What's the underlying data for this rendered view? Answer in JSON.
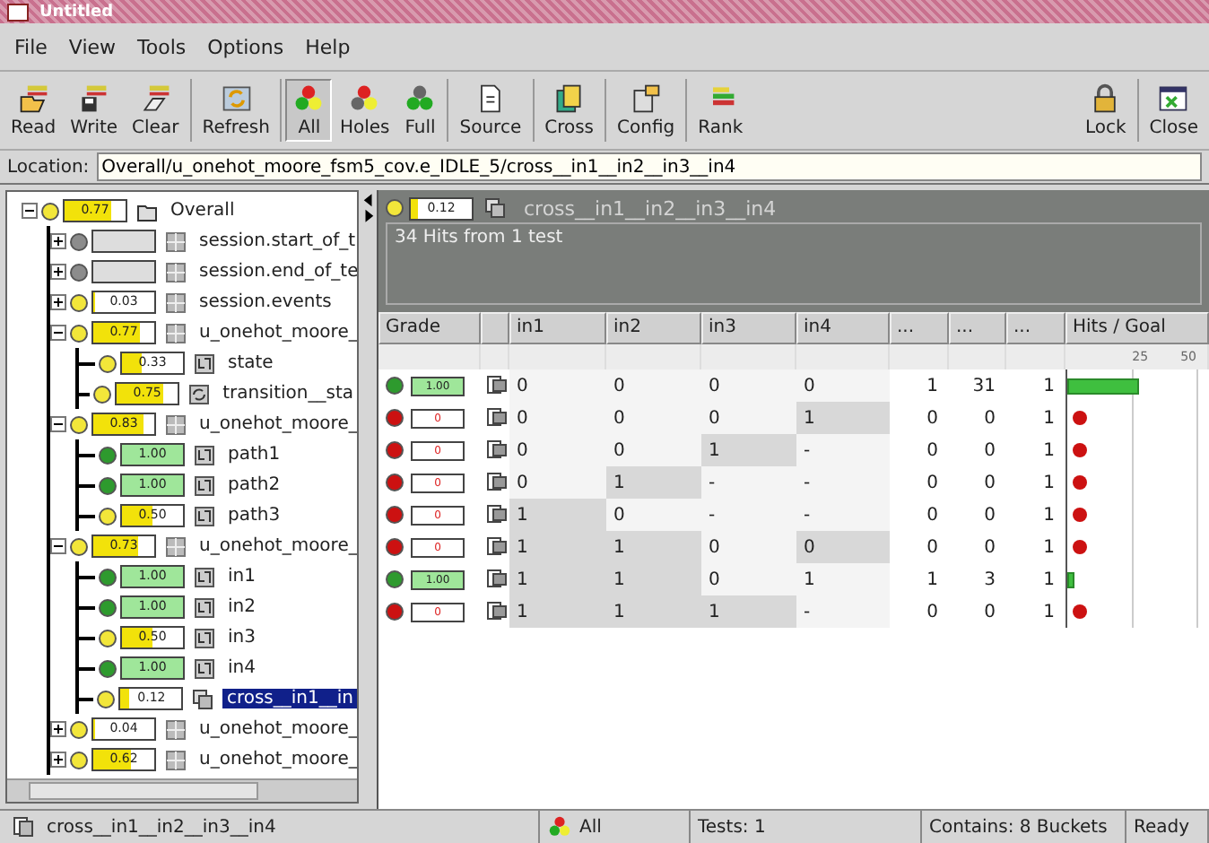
{
  "window": {
    "title": "Untitled"
  },
  "menu": [
    "File",
    "View",
    "Tools",
    "Options",
    "Help"
  ],
  "toolbar": [
    {
      "label": "Read",
      "kind": "read",
      "selected": false
    },
    {
      "label": "Write",
      "kind": "write",
      "selected": false
    },
    {
      "label": "Clear",
      "kind": "clear",
      "selected": false
    },
    {
      "label": "Refresh",
      "kind": "refresh",
      "selected": false
    },
    {
      "label": "All",
      "kind": "all",
      "selected": true
    },
    {
      "label": "Holes",
      "kind": "holes",
      "selected": false
    },
    {
      "label": "Full",
      "kind": "full",
      "selected": false
    },
    {
      "label": "Source",
      "kind": "source",
      "selected": false
    },
    {
      "label": "Cross",
      "kind": "cross",
      "selected": false
    },
    {
      "label": "Config",
      "kind": "config",
      "selected": false
    },
    {
      "label": "Rank",
      "kind": "rank",
      "selected": false
    }
  ],
  "toolbar_right": [
    {
      "label": "Lock",
      "kind": "lock"
    },
    {
      "label": "Close",
      "kind": "close"
    }
  ],
  "location": {
    "label": "Location:",
    "value": "Overall/u_onehot_moore_fsm5_cov.e_IDLE_5/cross__in1__in2__in3__in4"
  },
  "tree": {
    "items": [
      {
        "label": "Overall",
        "score": "0.77",
        "level": 0.77,
        "color": "#f2e63a",
        "kind": "folder",
        "expanded": true,
        "selected": false,
        "children": [
          {
            "label": "session.start_of_t",
            "color": "#8c8c8c",
            "kind": "group",
            "expanded": false,
            "selected": false
          },
          {
            "label": "session.end_of_te",
            "color": "#8c8c8c",
            "kind": "group",
            "expanded": false,
            "selected": false
          },
          {
            "label": "session.events",
            "score": "0.03",
            "level": 0.03,
            "color": "#f2e63a",
            "kind": "group",
            "expanded": false,
            "selected": false
          },
          {
            "label": "u_onehot_moore_",
            "score": "0.77",
            "level": 0.77,
            "color": "#f2e63a",
            "kind": "group",
            "expanded": true,
            "selected": false,
            "children": [
              {
                "label": "state",
                "score": "0.33",
                "level": 0.33,
                "color": "#f2e63a",
                "kind": "item",
                "selected": false
              },
              {
                "label": "transition__sta",
                "score": "0.75",
                "level": 0.75,
                "color": "#f2e63a",
                "kind": "transition",
                "selected": false
              }
            ]
          },
          {
            "label": "u_onehot_moore_",
            "score": "0.83",
            "level": 0.83,
            "color": "#f2e63a",
            "kind": "group",
            "expanded": true,
            "selected": false,
            "children": [
              {
                "label": "path1",
                "score": "1.00",
                "level": 1,
                "color": "#2e9a2e",
                "kind": "item",
                "selected": false
              },
              {
                "label": "path2",
                "score": "1.00",
                "level": 1,
                "color": "#2e9a2e",
                "kind": "item",
                "selected": false
              },
              {
                "label": "path3",
                "score": "0.50",
                "level": 0.5,
                "color": "#f2e63a",
                "kind": "item",
                "selected": false
              }
            ]
          },
          {
            "label": "u_onehot_moore_",
            "score": "0.73",
            "level": 0.73,
            "color": "#f2e63a",
            "kind": "group",
            "expanded": true,
            "selected": false,
            "children": [
              {
                "label": "in1",
                "score": "1.00",
                "level": 1,
                "color": "#2e9a2e",
                "kind": "item",
                "selected": false
              },
              {
                "label": "in2",
                "score": "1.00",
                "level": 1,
                "color": "#2e9a2e",
                "kind": "item",
                "selected": false
              },
              {
                "label": "in3",
                "score": "0.50",
                "level": 0.5,
                "color": "#f2e63a",
                "kind": "item",
                "selected": false
              },
              {
                "label": "in4",
                "score": "1.00",
                "level": 1,
                "color": "#2e9a2e",
                "kind": "item",
                "selected": false
              },
              {
                "label": "cross__in1__in",
                "score": "0.12",
                "level": 0.12,
                "color": "#f2e63a",
                "kind": "cross",
                "selected": true
              }
            ]
          },
          {
            "label": "u_onehot_moore_",
            "score": "0.04",
            "level": 0.04,
            "color": "#f2e63a",
            "kind": "group",
            "expanded": false,
            "selected": false
          },
          {
            "label": "u_onehot_moore_",
            "score": "0.62",
            "level": 0.62,
            "color": "#f2e63a",
            "kind": "group",
            "expanded": false,
            "selected": false
          }
        ]
      }
    ]
  },
  "detail": {
    "score": "0.12",
    "level": 0.12,
    "color": "#f2e63a",
    "title": "cross__in1__in2__in3__in4",
    "summary": "34 Hits from 1 test"
  },
  "table": {
    "columns": [
      "Grade",
      "in1",
      "in2",
      "in3",
      "in4",
      "...",
      "...",
      "...",
      "Hits / Goal"
    ],
    "ticks": [
      "25",
      "50"
    ],
    "rows": [
      {
        "color": "#2e9a2e",
        "cells": [
          {
            "text": "1.00",
            "shaded": false
          },
          {
            "text": "0",
            "shaded": false
          },
          {
            "text": "0",
            "shaded": false
          },
          {
            "text": "0",
            "shaded": false
          },
          {
            "text": "0",
            "shaded": false
          },
          {
            "text": "1",
            "shaded": false
          },
          {
            "text": "31",
            "shaded": false
          },
          {
            "text": "1",
            "shaded": false
          }
        ],
        "missed": false,
        "level": 0.5
      },
      {
        "color": "#cc1111",
        "cells": [
          {
            "text": "0",
            "shaded": false
          },
          {
            "text": "0",
            "shaded": false
          },
          {
            "text": "0",
            "shaded": false
          },
          {
            "text": "0",
            "shaded": false
          },
          {
            "text": "1",
            "shaded": true
          },
          {
            "text": "0",
            "shaded": false
          },
          {
            "text": "0",
            "shaded": false
          },
          {
            "text": "1",
            "shaded": false
          }
        ],
        "missed": true
      },
      {
        "color": "#cc1111",
        "cells": [
          {
            "text": "0",
            "shaded": false
          },
          {
            "text": "0",
            "shaded": false
          },
          {
            "text": "0",
            "shaded": false
          },
          {
            "text": "1",
            "shaded": true
          },
          {
            "text": "-",
            "shaded": false
          },
          {
            "text": "0",
            "shaded": false
          },
          {
            "text": "0",
            "shaded": false
          },
          {
            "text": "1",
            "shaded": false
          }
        ],
        "missed": true
      },
      {
        "color": "#cc1111",
        "cells": [
          {
            "text": "0",
            "shaded": false
          },
          {
            "text": "0",
            "shaded": false
          },
          {
            "text": "1",
            "shaded": true
          },
          {
            "text": "-",
            "shaded": false
          },
          {
            "text": "-",
            "shaded": false
          },
          {
            "text": "0",
            "shaded": false
          },
          {
            "text": "0",
            "shaded": false
          },
          {
            "text": "1",
            "shaded": false
          }
        ],
        "missed": true
      },
      {
        "color": "#cc1111",
        "cells": [
          {
            "text": "0",
            "shaded": false
          },
          {
            "text": "1",
            "shaded": true
          },
          {
            "text": "0",
            "shaded": false
          },
          {
            "text": "-",
            "shaded": false
          },
          {
            "text": "-",
            "shaded": false
          },
          {
            "text": "0",
            "shaded": false
          },
          {
            "text": "0",
            "shaded": false
          },
          {
            "text": "1",
            "shaded": false
          }
        ],
        "missed": true
      },
      {
        "color": "#cc1111",
        "cells": [
          {
            "text": "0",
            "shaded": false
          },
          {
            "text": "1",
            "shaded": true
          },
          {
            "text": "1",
            "shaded": true
          },
          {
            "text": "0",
            "shaded": false
          },
          {
            "text": "0",
            "shaded": true
          },
          {
            "text": "0",
            "shaded": false
          },
          {
            "text": "0",
            "shaded": false
          },
          {
            "text": "1",
            "shaded": false
          }
        ],
        "missed": true
      },
      {
        "color": "#2e9a2e",
        "cells": [
          {
            "text": "1.00",
            "shaded": false
          },
          {
            "text": "1",
            "shaded": true
          },
          {
            "text": "1",
            "shaded": true
          },
          {
            "text": "0",
            "shaded": false
          },
          {
            "text": "1",
            "shaded": false
          },
          {
            "text": "1",
            "shaded": false
          },
          {
            "text": "3",
            "shaded": false
          },
          {
            "text": "1",
            "shaded": false
          }
        ],
        "missed": false,
        "level": 0.05
      },
      {
        "color": "#cc1111",
        "cells": [
          {
            "text": "0",
            "shaded": false
          },
          {
            "text": "1",
            "shaded": true
          },
          {
            "text": "1",
            "shaded": true
          },
          {
            "text": "1",
            "shaded": true
          },
          {
            "text": "-",
            "shaded": false
          },
          {
            "text": "0",
            "shaded": false
          },
          {
            "text": "0",
            "shaded": false
          },
          {
            "text": "1",
            "shaded": false
          }
        ],
        "missed": true
      }
    ]
  },
  "status_bar": {
    "path": "cross__in1__in2__in3__in4",
    "filter": "All",
    "tests": "Tests: 1",
    "contains": "Contains: 8 Buckets",
    "state": "Ready"
  }
}
